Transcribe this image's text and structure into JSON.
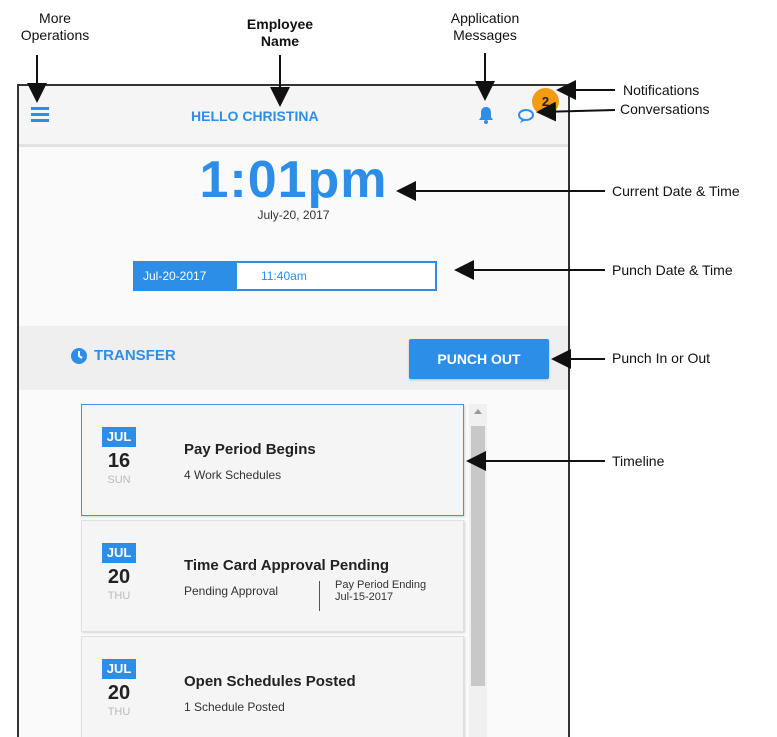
{
  "callouts": {
    "more_operations": "More\nOperations",
    "employee_name": "Employee\nName",
    "application_messages": "Application\nMessages",
    "notifications": "Notifications",
    "conversations": "Conversations",
    "current_date_time": "Current Date & Time",
    "punch_date_time": "Punch Date & Time",
    "punch_in_out": "Punch In or Out",
    "timeline": "Timeline"
  },
  "header": {
    "greeting": "HELLO CHRISTINA",
    "notification_count": "2",
    "menu_icon": "hamburger-icon",
    "bell_icon": "bell-icon",
    "chat_icon": "chat-bubbles-icon"
  },
  "clock": {
    "time": "1:01pm",
    "date": "July-20, 2017"
  },
  "punch": {
    "date": "Jul-20-2017",
    "time": "11:40am"
  },
  "actions": {
    "transfer_label": "TRANSFER",
    "punch_button_label": "PUNCH OUT"
  },
  "timeline": {
    "items": [
      {
        "month": "JUL",
        "day": "16",
        "dow": "SUN",
        "title": "Pay Period Begins",
        "subtitle": "4 Work Schedules",
        "side": ""
      },
      {
        "month": "JUL",
        "day": "20",
        "dow": "THU",
        "title": "Time Card Approval Pending",
        "subtitle": "Pending Approval",
        "side": "Pay Period Ending\nJul-15-2017"
      },
      {
        "month": "JUL",
        "day": "20",
        "dow": "THU",
        "title": "Open Schedules Posted",
        "subtitle": "1 Schedule Posted",
        "side": ""
      }
    ]
  },
  "colors": {
    "accent": "#2d8ee8",
    "badge": "#f39c12"
  }
}
